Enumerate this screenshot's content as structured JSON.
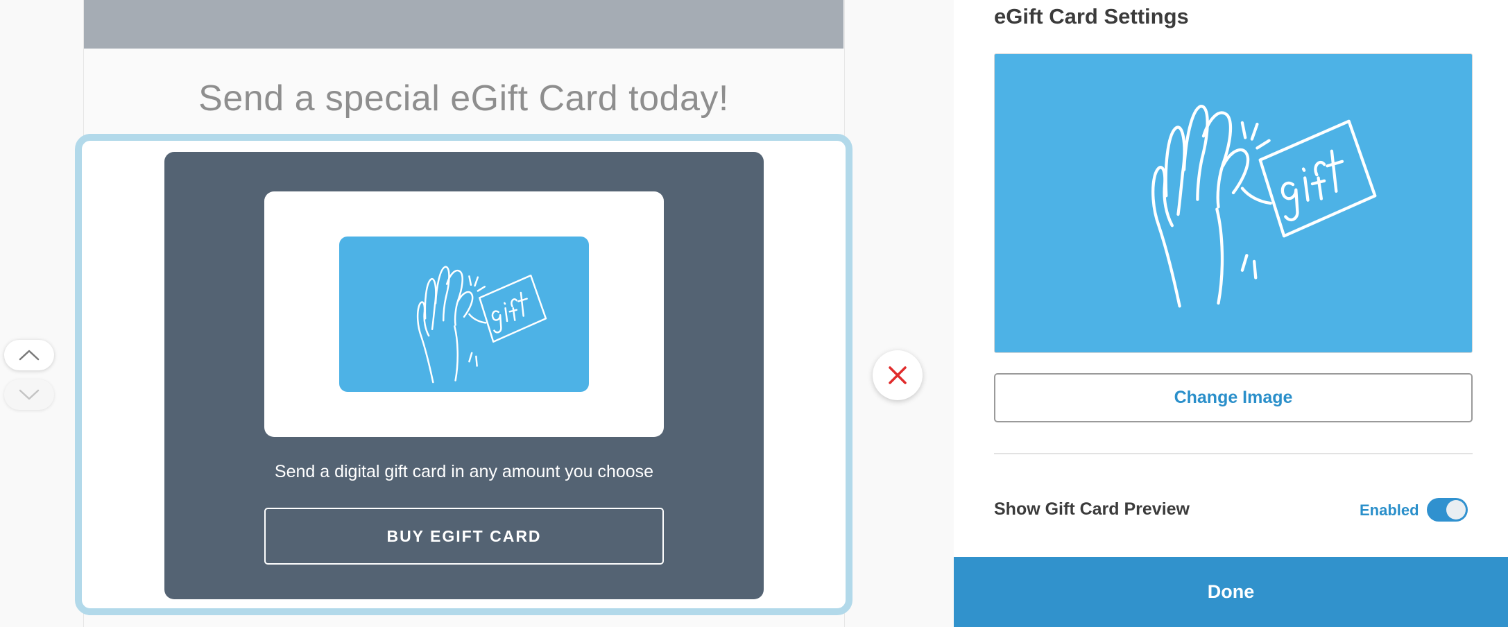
{
  "editor": {
    "headline": "Send a special eGift Card today!",
    "block": {
      "description": "Send a digital gift card in any amount you choose",
      "button_label": "BUY EGIFT CARD",
      "card_art_icon": "hand-gift-icon"
    },
    "controls": {
      "move_up_icon": "chevron-up-icon",
      "move_down_icon": "chevron-down-icon",
      "delete_icon": "close-icon"
    }
  },
  "settings_panel": {
    "title": "eGift Card Settings",
    "preview_icon": "hand-gift-icon",
    "change_image_label": "Change Image",
    "show_preview_label": "Show Gift Card Preview",
    "show_preview_state": "Enabled",
    "show_preview_enabled": true,
    "done_label": "Done"
  },
  "colors": {
    "accent": "#2a8fca",
    "card_blue": "#4db2e6",
    "block_dark": "#546373",
    "selection": "#b2d9ea",
    "delete_red": "#e02b2b"
  }
}
